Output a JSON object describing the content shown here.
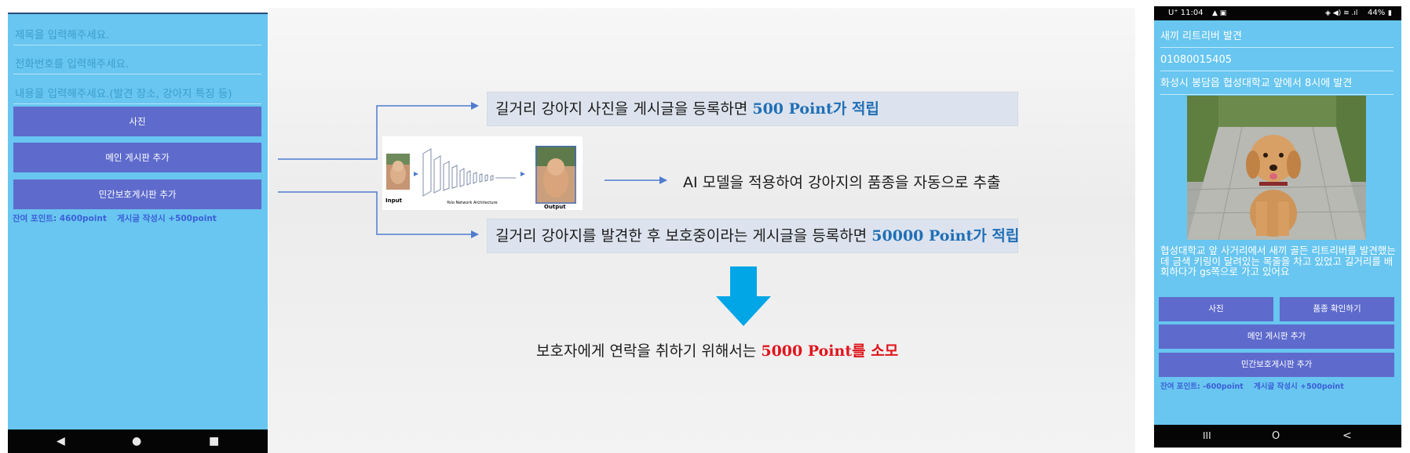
{
  "left_phone": {
    "title_placeholder": "제목을 입력해주세요.",
    "phone_placeholder": "전화번호를 입력해주세요.",
    "content_placeholder": "내용을 입력해주세요.(발견 장소, 강아지 특징 등)",
    "photo_button": "사진",
    "main_board_button": "메인 게시판 추가",
    "shelter_board_button": "민간보호게시판 추가",
    "points_remaining": "잔여 포인트: 4600point",
    "points_bonus": "게시글 작성시 +500point",
    "nav_back": "◀",
    "nav_home": "●",
    "nav_recent": "■"
  },
  "slide": {
    "reward_photo_text": "길거리 강아지 사진을 게시글을 등록하면 ",
    "reward_photo_points": "500 Point가 적립",
    "model_caption_input": "Input",
    "model_caption_arch": "Yolo Network Architecture",
    "model_caption_output": "Output",
    "ai_text": "AI 모델을 적용하여 강아지의 품종을 자동으로 추출",
    "reward_shelter_text": "길거리 강아지를 발견한 후 보호중이라는 게시글을 등록하면 ",
    "reward_shelter_points": "50000 Point가 적립",
    "contact_text": "보호자에게 연락을 취하기 위해서는 ",
    "contact_points": "5000 Point를 소모",
    "colors": {
      "arrow_blue": "#00a6e6",
      "highlight_blue": "#1f6fb6",
      "highlight_red": "#e0141c"
    }
  },
  "right_phone": {
    "status_time": "U⁺ 11:04",
    "status_right": "44%",
    "title": "새끼 리트리버 발견",
    "phone": "01080015405",
    "location": "화성시 봉담읍 협성대학교 앞에서 8시에 발견",
    "description": "협성대학교 앞 사거리에서 새끼 골든 리트리버를 발견했는데 금색 키링이 달려있는 목줄을 차고 있었고 길거리를 배회하다가 gs쪽으로 가고 있어요",
    "photo_button": "사진",
    "breed_button": "품종 확인하기",
    "main_board_button": "메인 게시판 추가",
    "shelter_board_button": "민간보호게시판 추가",
    "points_remaining": "잔여 포인트: -600point",
    "points_bonus": "게시글 작성시 +500point",
    "nav_recent": "III",
    "nav_home": "O",
    "nav_back": "<"
  }
}
